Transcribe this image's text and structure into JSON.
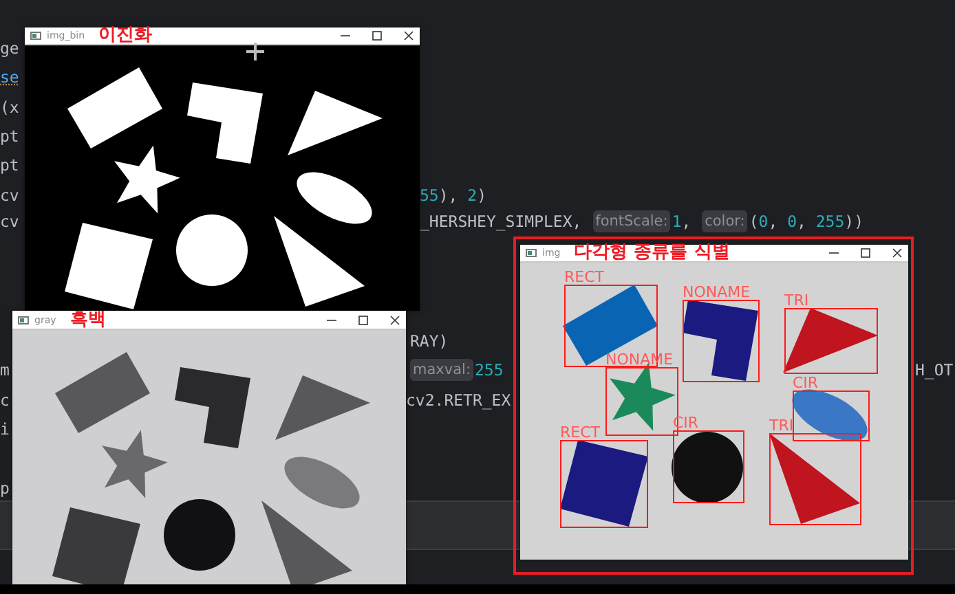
{
  "editor": {
    "lines": [
      {
        "fragments": [
          {
            "segments": [
              {
                "text": "ge",
                "kind": "code"
              }
            ]
          }
        ]
      },
      {
        "fragments": [
          {
            "segments": [
              {
                "text": "se",
                "kind": "keyword"
              }
            ]
          }
        ]
      },
      {
        "fragments": [
          {
            "segments": [
              {
                "text": "(x",
                "kind": "code"
              }
            ]
          }
        ]
      },
      {
        "fragments": [
          {
            "segments": [
              {
                "text": "pt",
                "kind": "code"
              }
            ]
          }
        ]
      },
      {
        "fragments": [
          {
            "segments": [
              {
                "text": "pt",
                "kind": "code"
              }
            ]
          }
        ]
      },
      {
        "fragments": [
          {
            "segments": [
              {
                "text": "cv",
                "kind": "code"
              }
            ]
          },
          {
            "segments": [
              {
                "text": "55",
                "kind": "number"
              },
              {
                "text": "), ",
                "kind": "code"
              },
              {
                "text": "2",
                "kind": "number"
              },
              {
                "text": ")",
                "kind": "code"
              }
            ]
          }
        ]
      },
      {
        "fragments": [
          {
            "segments": [
              {
                "text": "cv",
                "kind": "code"
              }
            ]
          },
          {
            "segments": [
              {
                "text": "_HERSHEY_SIMPLEX, ",
                "kind": "code"
              },
              {
                "text": "fontScale:",
                "kind": "hint"
              },
              {
                "text": "1",
                "kind": "number"
              },
              {
                "text": ", ",
                "kind": "code"
              },
              {
                "text": "color:",
                "kind": "hint"
              },
              {
                "text": "(",
                "kind": "code"
              },
              {
                "text": "0",
                "kind": "number"
              },
              {
                "text": ", ",
                "kind": "code"
              },
              {
                "text": "0",
                "kind": "number"
              },
              {
                "text": ", ",
                "kind": "code"
              },
              {
                "text": "255",
                "kind": "number"
              },
              {
                "text": "))",
                "kind": "code"
              }
            ]
          }
        ]
      },
      {
        "fragments": [
          {
            "segments": [
              {
                "text": "RAY)",
                "kind": "code"
              }
            ]
          }
        ]
      },
      {
        "fragments": [
          {
            "segments": [
              {
                "text": "m",
                "kind": "code"
              }
            ]
          },
          {
            "segments": [
              {
                "text": "maxval:",
                "kind": "hint"
              },
              {
                "text": "255",
                "kind": "number"
              }
            ]
          },
          {
            "segments": [
              {
                "text": "H_OT",
                "kind": "code"
              }
            ]
          }
        ]
      },
      {
        "fragments": [
          {
            "segments": [
              {
                "text": "c",
                "kind": "code"
              }
            ]
          },
          {
            "segments": [
              {
                "text": "cv2.RETR_EX",
                "kind": "code"
              }
            ]
          }
        ]
      },
      {
        "fragments": [
          {
            "segments": [
              {
                "text": "i",
                "kind": "code"
              }
            ]
          }
        ]
      },
      {
        "fragments": [
          {
            "segments": [
              {
                "text": "p",
                "kind": "code"
              }
            ]
          }
        ]
      }
    ]
  },
  "windows": [
    {
      "title": "img_bin",
      "caption": "이진화",
      "kind": "binary"
    },
    {
      "title": "gray",
      "caption": "흑백",
      "kind": "grayscale"
    },
    {
      "title": "img",
      "caption": "다각형 종류를 식별",
      "kind": "color",
      "detections": [
        {
          "label": "RECT"
        },
        {
          "label": "NONAME"
        },
        {
          "label": "TRI"
        },
        {
          "label": "NONAME"
        },
        {
          "label": "CIR"
        },
        {
          "label": "RECT"
        },
        {
          "label": "CIR"
        },
        {
          "label": "TRI"
        }
      ]
    }
  ]
}
